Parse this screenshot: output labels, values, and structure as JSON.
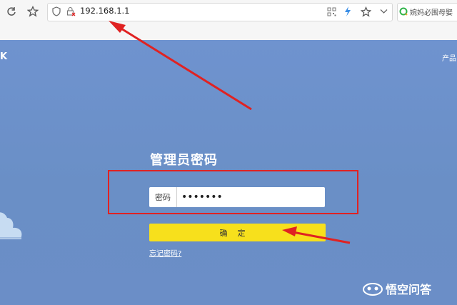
{
  "browser": {
    "url": "192.168.1.1",
    "search_text": "婉妈必围母娶",
    "icons": [
      "refresh-icon",
      "star-icon",
      "shield-icon",
      "not-secure-icon",
      "qr-icon",
      "lightning-icon",
      "bookmark-star-icon",
      "chevron-down-icon",
      "search-engine-icon"
    ]
  },
  "page": {
    "brand": "K",
    "nav_link": "产品",
    "title": "管理员密码",
    "password_label": "密码",
    "password_value": "•••••••",
    "confirm_button": "确定",
    "forgot_link": "忘记密码?"
  },
  "watermark": {
    "text": "悟空问答"
  },
  "colors": {
    "page_background": "#6e8fc8",
    "confirm_button": "#f7e01c",
    "annotation": "#e02222"
  }
}
